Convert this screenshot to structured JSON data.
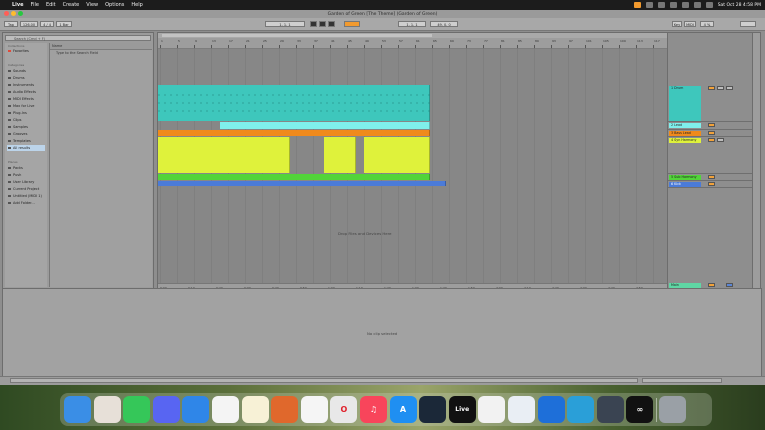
{
  "menubar": {
    "apple": "",
    "items": [
      "Live",
      "File",
      "Edit",
      "Create",
      "View",
      "Options",
      "Help"
    ],
    "clock": "Sat Oct 28 4:58 PM"
  },
  "window": {
    "title": "Garden of Green [The Theme] (Garden of Green)"
  },
  "transport": {
    "tap": "Tap",
    "tempo": "126.00",
    "signature": "4 / 4",
    "metronome": "1 Bar",
    "position": "1. 1. 1",
    "loop_start": "1. 1. 1",
    "loop_length": "49. 0. 0",
    "key": "Key",
    "midi": "MIDI",
    "cpu": "4 %"
  },
  "browser": {
    "search_placeholder": "Search (Cmd + F)",
    "collections_label": "Collections",
    "favorites": "Favorites",
    "categories_label": "Categories",
    "categories": [
      "Sounds",
      "Drums",
      "Instruments",
      "Audio Effects",
      "MIDI Effects",
      "Max for Live",
      "Plug-Ins",
      "Clips",
      "Samples",
      "Grooves",
      "Templates",
      "All results"
    ],
    "places_label": "Places",
    "places": [
      "Packs",
      "Push",
      "User Library",
      "Current Project",
      "Untitled (MIDI 1)",
      "Add Folder..."
    ],
    "list_header": "Name",
    "list_items": [
      "Type to the Search Field"
    ]
  },
  "arrangement": {
    "ruler": [
      "1",
      "5",
      "9",
      "13",
      "17",
      "21",
      "25",
      "29",
      "33",
      "37",
      "41",
      "45",
      "49",
      "53",
      "57",
      "61",
      "65",
      "69",
      "73",
      "77",
      "81",
      "85",
      "89",
      "93",
      "97",
      "101",
      "105",
      "109",
      "113",
      "117"
    ],
    "time_labels": [
      "0:00",
      "0:10",
      "0:20",
      "0:30",
      "0:40",
      "0:50",
      "1:00",
      "1:10",
      "1:20",
      "1:30",
      "1:40",
      "1:50",
      "2:00",
      "2:10",
      "2:20",
      "2:30",
      "2:40",
      "2:50"
    ],
    "drop_message": "Drop Files and Devices Here",
    "colors": {
      "teal": "#3ec7bc",
      "cyan": "#7ff0ec",
      "orange": "#f08a1c",
      "yellow": "#dff23b",
      "green": "#52d43a",
      "blue": "#4b7bd8"
    }
  },
  "tracks": [
    {
      "name": "1 Drum",
      "color": "#3ec7bc"
    },
    {
      "name": "2 Lead",
      "color": "#7ff0ec"
    },
    {
      "name": "3 Bass Lead",
      "color": "#f08a1c"
    },
    {
      "name": "4 Syn Harmony",
      "color": "#dff23b"
    },
    {
      "name": "5 Sub Harmony",
      "color": "#52d43a"
    },
    {
      "name": "6 Kick",
      "color": "#4b7bd8"
    },
    {
      "name": "Main",
      "color": "#5fd6a4"
    }
  ],
  "detail": {
    "message": "No clip selected"
  },
  "dock": {
    "apps": [
      {
        "icon": "finder-icon",
        "glyph": "",
        "color": "#3a8ee6"
      },
      {
        "icon": "launchpad-icon",
        "glyph": "",
        "color": "#e7e0d8"
      },
      {
        "icon": "messages-icon",
        "glyph": "",
        "color": "#35c759"
      },
      {
        "icon": "discord-icon",
        "glyph": "",
        "color": "#5865f2"
      },
      {
        "icon": "mail-icon",
        "glyph": "",
        "color": "#2f86e8"
      },
      {
        "icon": "photos-icon",
        "glyph": "",
        "color": "#f4f4f4"
      },
      {
        "icon": "notes-icon",
        "glyph": "",
        "color": "#f7f1d6"
      },
      {
        "icon": "tuner-icon",
        "glyph": "",
        "color": "#e0682c"
      },
      {
        "icon": "reminders-icon",
        "glyph": "",
        "color": "#f5f5f5"
      },
      {
        "icon": "opera-icon",
        "glyph": "O",
        "color": "#e8e8e8"
      },
      {
        "icon": "music-icon",
        "glyph": "♫",
        "color": "#f8455b"
      },
      {
        "icon": "app-store-icon",
        "glyph": "A",
        "color": "#1f8ff2"
      },
      {
        "icon": "steam-icon",
        "glyph": "",
        "color": "#1b2838"
      },
      {
        "icon": "ableton-live-icon",
        "glyph": "Live",
        "color": "#111111"
      },
      {
        "icon": "capcut-icon",
        "glyph": "",
        "color": "#f2f2f2"
      },
      {
        "icon": "preview-icon",
        "glyph": "",
        "color": "#e9eef4"
      },
      {
        "icon": "windows-icon",
        "glyph": "",
        "color": "#1e6fd9"
      },
      {
        "icon": "visual-studio-code-icon",
        "glyph": "",
        "color": "#2a9fd8"
      },
      {
        "icon": "unity-icon",
        "glyph": "",
        "color": "#3a4452"
      },
      {
        "icon": "meta-icon",
        "glyph": "∞",
        "color": "#111111"
      },
      {
        "icon": "trash-icon",
        "glyph": "",
        "color": "#9aa0a6"
      }
    ]
  }
}
